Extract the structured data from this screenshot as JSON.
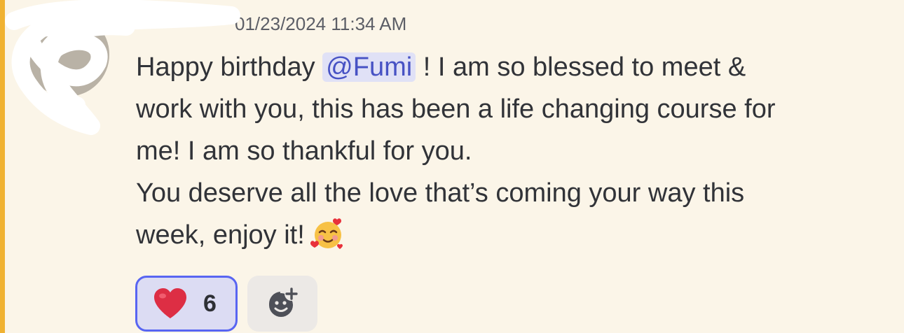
{
  "message": {
    "author": "",
    "timestamp": "01/23/2024 11:34 AM",
    "line1_before": "Happy birthday ",
    "mention": "@Fumi",
    "line1_after": " ! I am so blessed to meet &",
    "line2": "work with you, this has been a life changing course for",
    "line3": "me! I am so thankful for you.",
    "line4": "You deserve all the love that’s coming your way this",
    "line5": "week, enjoy it!",
    "emoji": "smiling-face-with-hearts"
  },
  "reactions": [
    {
      "emoji": "red-heart",
      "count": "6",
      "selected": true
    }
  ],
  "add_reaction": {
    "icon": "add-reaction-icon"
  },
  "colors": {
    "highlight": "#f0b232",
    "background": "#fbf5e8",
    "mention_bg": "#e0e1f6",
    "mention_text": "#4752c4",
    "reaction_border": "#5865f2"
  }
}
